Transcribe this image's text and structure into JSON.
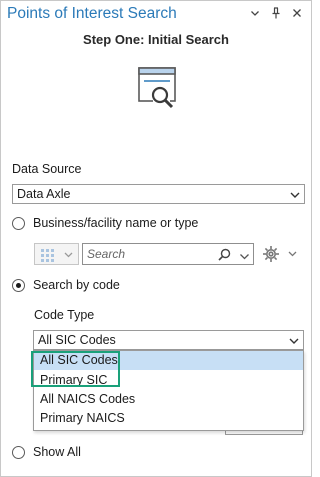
{
  "pane": {
    "title": "Points of Interest Search",
    "step_title": "Step One: Initial Search"
  },
  "data_source": {
    "label": "Data Source",
    "value": "Data Axle"
  },
  "search_mode": {
    "business_option": "Business/facility name or type",
    "code_option": "Search by code",
    "show_all_option": "Show All",
    "selected": "Search by code"
  },
  "search": {
    "placeholder": "Search"
  },
  "code_type": {
    "label": "Code Type",
    "value": "All SIC Codes",
    "options": [
      "All SIC Codes",
      "Primary SIC",
      "All NAICS Codes",
      "Primary NAICS"
    ]
  },
  "icons": {
    "menu": "chevron-down-icon",
    "pin": "pin-icon",
    "close": "close-icon",
    "hero": "window-search-icon",
    "grid": "grid-icon",
    "search": "search-icon",
    "gear": "gear-icon"
  },
  "colors": {
    "title": "#2b7ab8",
    "selected_bg": "#c7dff5",
    "highlight": "#1aa17a"
  }
}
